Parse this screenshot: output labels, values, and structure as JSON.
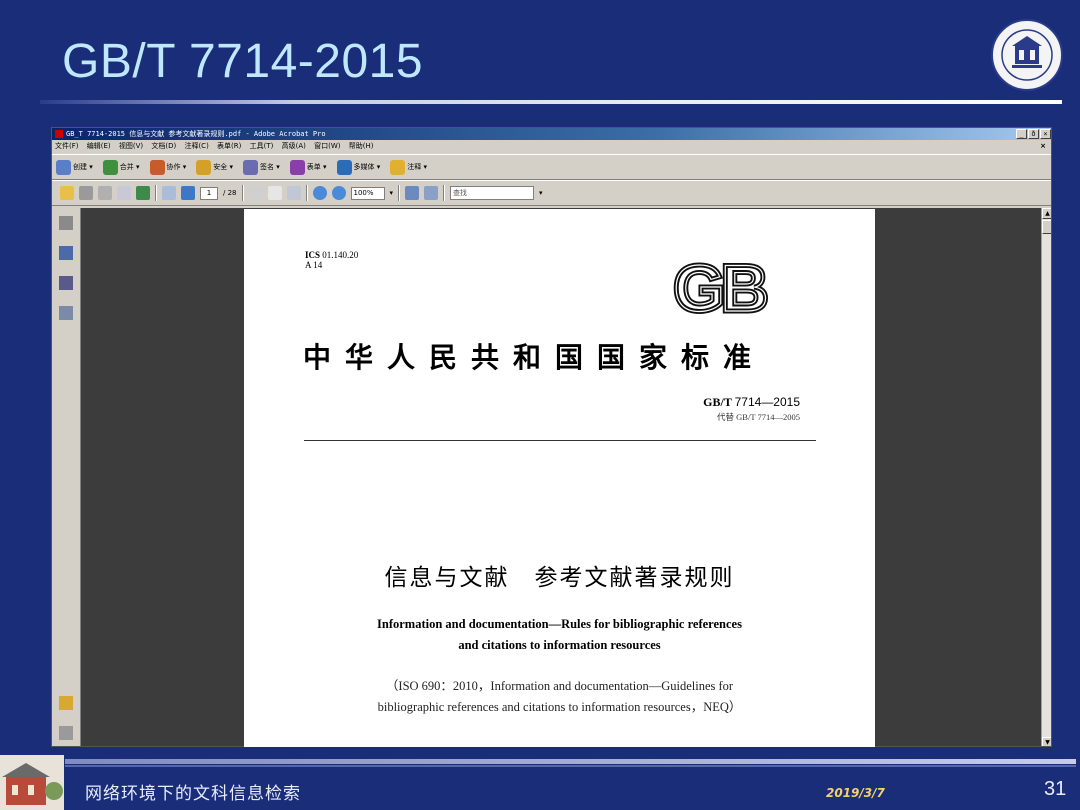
{
  "slide": {
    "title": "GB/T 7714-2015",
    "footer_course": "网络环境下的文科信息检索",
    "footer_date": "2019/3/7",
    "page_number": "31"
  },
  "window": {
    "title": "GB_T 7714-2015 信息与文献 参考文献著录规则.pdf - Adobe Acrobat Pro",
    "controls": [
      "_",
      "ð",
      "×"
    ],
    "menu": [
      "文件(F)",
      "编辑(E)",
      "视图(V)",
      "文档(D)",
      "注释(C)",
      "表单(R)",
      "工具(T)",
      "高级(A)",
      "窗口(W)",
      "帮助(H)"
    ],
    "menu_close": "×",
    "toolbar1": [
      {
        "label": "创建 ▾",
        "icon": "create-pdf-icon",
        "color": "#5a7ec8"
      },
      {
        "label": "合并 ▾",
        "icon": "combine-icon",
        "color": "#3f8f3f"
      },
      {
        "label": "协作 ▾",
        "icon": "collaborate-icon",
        "color": "#c65b2c"
      },
      {
        "label": "安全 ▾",
        "icon": "lock-icon",
        "color": "#d4a02a"
      },
      {
        "label": "签名 ▾",
        "icon": "sign-pen-icon",
        "color": "#6b6bb0"
      },
      {
        "label": "表单 ▾",
        "icon": "forms-icon",
        "color": "#8a3ea8"
      },
      {
        "label": "多媒体 ▾",
        "icon": "multimedia-icon",
        "color": "#2c6bb8"
      },
      {
        "label": "注释 ▾",
        "icon": "comment-icon",
        "color": "#e0b030"
      }
    ],
    "toolbar2": {
      "page_current": "1",
      "page_total": "/ 28",
      "zoom": "100%",
      "find_placeholder": "查找"
    }
  },
  "document": {
    "ics": "ICS",
    "ics_code": "01.140.20",
    "class_code": "A 14",
    "standard_title": "中华人民共和国国家标准",
    "std_prefix": "GB/T",
    "std_number": "7714—2015",
    "replaces": "代替 GB/T 7714—2005",
    "cn_title": "信息与文献　参考文献著录规则",
    "en_title_1": "Information and documentation—Rules for bibliographic references",
    "en_title_2": "and citations to information resources",
    "iso_1": "（ISO 690：2010，Information and documentation—Guidelines for",
    "iso_2": "bibliographic references and citations to information resources，NEQ）",
    "gb_logo_text": "GB"
  },
  "colors": {
    "slide_bg": "#1a2d78",
    "title": "#bfe8ff",
    "date": "#f2d36a"
  }
}
